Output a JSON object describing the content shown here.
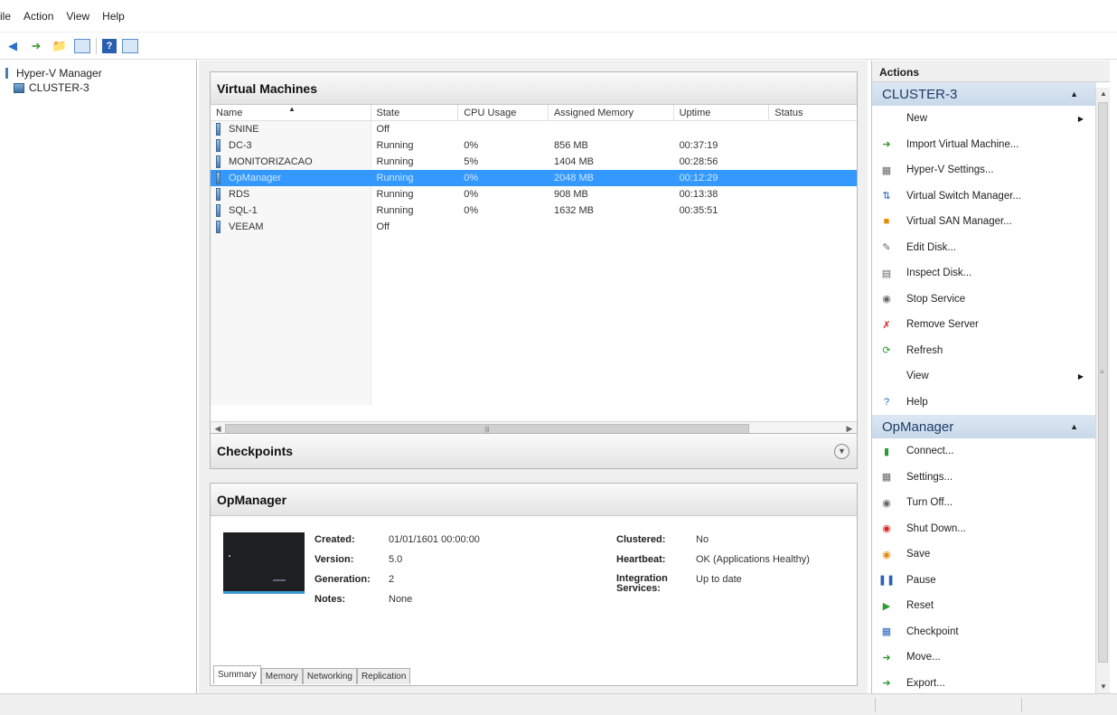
{
  "menu": [
    "ile",
    "Action",
    "View",
    "Help"
  ],
  "tree": {
    "root": "Hyper-V Manager",
    "child": "CLUSTER-3"
  },
  "vm_panel": {
    "title": "Virtual Machines",
    "columns": [
      "Name",
      "State",
      "CPU Usage",
      "Assigned Memory",
      "Uptime",
      "Status"
    ],
    "rows": [
      {
        "name": "SNINE",
        "state": "Off",
        "cpu": "",
        "mem": "",
        "uptime": "",
        "status": ""
      },
      {
        "name": "DC-3",
        "state": "Running",
        "cpu": "0%",
        "mem": "856 MB",
        "uptime": "00:37:19",
        "status": ""
      },
      {
        "name": "MONITORIZACAO",
        "state": "Running",
        "cpu": "5%",
        "mem": "1404 MB",
        "uptime": "00:28:56",
        "status": ""
      },
      {
        "name": "OpManager",
        "state": "Running",
        "cpu": "0%",
        "mem": "2048 MB",
        "uptime": "00:12:29",
        "status": ""
      },
      {
        "name": "RDS",
        "state": "Running",
        "cpu": "0%",
        "mem": "908 MB",
        "uptime": "00:13:38",
        "status": ""
      },
      {
        "name": "SQL-1",
        "state": "Running",
        "cpu": "0%",
        "mem": "1632 MB",
        "uptime": "00:35:51",
        "status": ""
      },
      {
        "name": "VEEAM",
        "state": "Off",
        "cpu": "",
        "mem": "",
        "uptime": "",
        "status": ""
      }
    ],
    "selected_index": 3
  },
  "checkpoints": {
    "title": "Checkpoints"
  },
  "details": {
    "title": "OpManager",
    "left": [
      {
        "k": "Created:",
        "v": "01/01/1601 00:00:00"
      },
      {
        "k": "Version:",
        "v": "5.0"
      },
      {
        "k": "Generation:",
        "v": "2"
      },
      {
        "k": "Notes:",
        "v": "None"
      }
    ],
    "right": [
      {
        "k": "Clustered:",
        "v": "No"
      },
      {
        "k": "Heartbeat:",
        "v": "OK (Applications Healthy)"
      },
      {
        "k": "Integration Services:",
        "v": "Up to date"
      }
    ],
    "tabs": [
      "Summary",
      "Memory",
      "Networking",
      "Replication"
    ]
  },
  "actions": {
    "title": "Actions",
    "sections": [
      {
        "name": "CLUSTER-3",
        "items": [
          {
            "label": "New",
            "icon": "none",
            "submenu": true
          },
          {
            "label": "Import Virtual Machine...",
            "icon": "import-icon"
          },
          {
            "label": "Hyper-V Settings...",
            "icon": "settings-icon"
          },
          {
            "label": "Virtual Switch Manager...",
            "icon": "switch-icon"
          },
          {
            "label": "Virtual SAN Manager...",
            "icon": "san-icon"
          },
          {
            "label": "Edit Disk...",
            "icon": "edit-disk-icon"
          },
          {
            "label": "Inspect Disk...",
            "icon": "inspect-disk-icon"
          },
          {
            "label": "Stop Service",
            "icon": "stop-icon"
          },
          {
            "label": "Remove Server",
            "icon": "remove-icon"
          },
          {
            "label": "Refresh",
            "icon": "refresh-icon"
          },
          {
            "label": "View",
            "icon": "none",
            "submenu": true
          },
          {
            "label": "Help",
            "icon": "help-icon"
          }
        ]
      },
      {
        "name": "OpManager",
        "items": [
          {
            "label": "Connect...",
            "icon": "connect-icon"
          },
          {
            "label": "Settings...",
            "icon": "vm-settings-icon"
          },
          {
            "label": "Turn Off...",
            "icon": "turn-off-icon"
          },
          {
            "label": "Shut Down...",
            "icon": "shutdown-icon"
          },
          {
            "label": "Save",
            "icon": "save-icon"
          },
          {
            "label": "Pause",
            "icon": "pause-icon"
          },
          {
            "label": "Reset",
            "icon": "reset-icon"
          },
          {
            "label": "Checkpoint",
            "icon": "checkpoint-icon"
          },
          {
            "label": "Move...",
            "icon": "move-icon"
          },
          {
            "label": "Export...",
            "icon": "export-icon"
          }
        ]
      }
    ]
  },
  "colors": {
    "selection": "#3399ff",
    "section_head": "#d3e1ef",
    "accent": "#2b63b8"
  }
}
